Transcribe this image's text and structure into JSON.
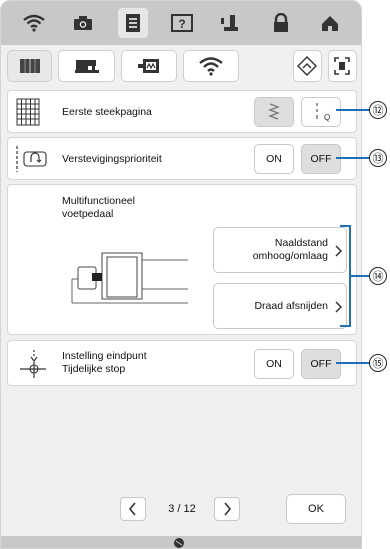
{
  "settings": {
    "row1": {
      "label": "Eerste steekpagina"
    },
    "row2": {
      "label": "Verstevigingsprioriteit",
      "on_label": "ON",
      "off_label": "OFF"
    },
    "row3": {
      "title_line1": "Multifunctioneel",
      "title_line2": "voetpedaal",
      "btn1_line1": "Naaldstand",
      "btn1_line2": "omhoog/omlaag",
      "btn2": "Draad afsnijden"
    },
    "row4": {
      "line1": "Instelling eindpunt",
      "line2": "Tijdelijke stop",
      "on_label": "ON",
      "off_label": "OFF"
    }
  },
  "pagination": {
    "text": "3 / 12",
    "ok_label": "OK"
  },
  "callouts": [
    "⑫",
    "⑬",
    "⑭",
    "⑮"
  ],
  "accent_color": "#1f6fb4"
}
